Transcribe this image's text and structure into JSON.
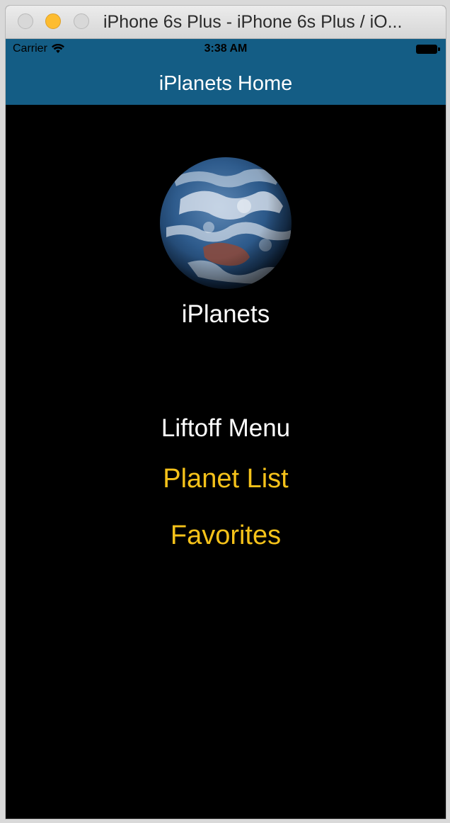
{
  "window": {
    "title": "iPhone 6s Plus - iPhone 6s Plus / iO..."
  },
  "status_bar": {
    "carrier": "Carrier",
    "time": "3:38 AM",
    "icons": [
      "wifi-icon",
      "battery-icon"
    ]
  },
  "nav_bar": {
    "title": "iPlanets Home",
    "color": "#145d85"
  },
  "main": {
    "image": "earth-planet-image",
    "app_name": "iPlanets",
    "menu_heading": "Liftoff Menu",
    "links": [
      {
        "label": "Planet List"
      },
      {
        "label": "Favorites"
      }
    ],
    "link_color": "#f5c21a",
    "background": "#000000"
  }
}
